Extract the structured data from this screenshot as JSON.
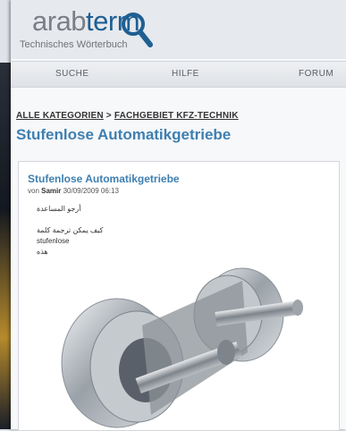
{
  "logo": {
    "part1": "arab",
    "part2": "term",
    "subtitle": "Technisches Wörterbuch"
  },
  "nav": {
    "items": [
      "SUCHE",
      "HILFE",
      "FORUM"
    ]
  },
  "breadcrumb": {
    "root": "ALLE KATEGORIEN",
    "sep": " > ",
    "current": "FACHGEBIET KFZ-TECHNIK"
  },
  "page_title": "Stufenlose Automatikgetriebe",
  "post": {
    "title": "Stufenlose Automatikgetriebe",
    "by": "von",
    "author": "Samir",
    "datetime": "30/09/2009 06:13",
    "lines": [
      "أرجو المساعدة",
      "كيف يمكن ترجمة كلمة",
      "stufenlose",
      "هذه"
    ]
  },
  "colors": {
    "accent": "#3e7fb0",
    "logo_term": "#1f5f93"
  },
  "icons": {
    "logo": "magnifier-icon"
  }
}
